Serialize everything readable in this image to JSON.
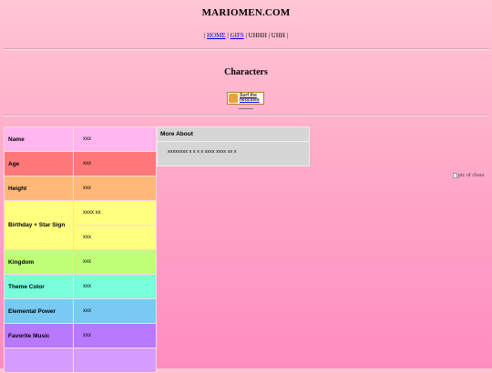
{
  "site": {
    "title": "MARIOMEN.COM"
  },
  "nav": {
    "home": "HOME",
    "gifs": "GIFS",
    "item3": "UHHH",
    "item4": "UHH"
  },
  "section": {
    "title": "Characters"
  },
  "badge": {
    "text_line1": "Surf the",
    "text_line2": "neocities",
    "icon": "neocities-cat-icon"
  },
  "profile": {
    "rows": [
      {
        "label": "Name",
        "value": "xxx",
        "color": "#ffb6ee"
      },
      {
        "label": "Age",
        "value": "xxx",
        "color": "#ff7878"
      },
      {
        "label": "Height",
        "value": "xxx",
        "color": "#ffb878"
      },
      {
        "label": "Birthday + Star Sign",
        "values": [
          "xxxx xx",
          "xxx"
        ],
        "color": "#ffff80"
      },
      {
        "label": "Kingdom",
        "value": "xxx",
        "color": "#bfff78"
      },
      {
        "label": "Theme Color",
        "value": "xxx",
        "color": "#78ffda"
      },
      {
        "label": "Elemental Power",
        "value": "xxx",
        "color": "#78caf2"
      },
      {
        "label": "Favorite Music",
        "value": "xxx",
        "color": "#b878ff"
      }
    ]
  },
  "about": {
    "heading": "More About",
    "body": "xxxxxxxx x x x x xxxx xxxx xx x"
  },
  "picture": {
    "alt": "pic of chara",
    "icon": "broken-image-icon"
  }
}
